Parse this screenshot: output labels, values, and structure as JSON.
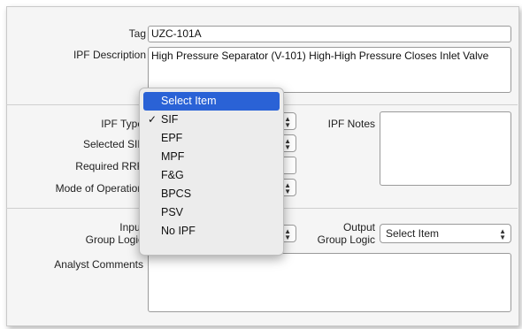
{
  "form": {
    "tag_label": "Tag",
    "tag_value": "UZC-101A",
    "ipf_description_label": "IPF Description",
    "ipf_description_value": "High Pressure Separator (V-101) High-High Pressure Closes Inlet Valve",
    "ipf_type_label": "IPF Type",
    "selected_sil_label": "Selected SIL",
    "required_rrf_label": "Required RRF",
    "mode_of_operation_label": "Mode of Operation",
    "ipf_notes_label": "IPF Notes",
    "input_group_logic_label_line1": "Input",
    "input_group_logic_label_line2": "Group Logic",
    "output_group_logic_label_line1": "Output",
    "output_group_logic_label_line2": "Group Logic",
    "output_group_logic_value": "Select Item",
    "analyst_comments_label": "Analyst Comments"
  },
  "dropdown": {
    "items": [
      {
        "label": "Select Item",
        "highlighted": true,
        "checked": false
      },
      {
        "label": "SIF",
        "highlighted": false,
        "checked": true
      },
      {
        "label": "EPF",
        "highlighted": false,
        "checked": false
      },
      {
        "label": "MPF",
        "highlighted": false,
        "checked": false
      },
      {
        "label": "F&G",
        "highlighted": false,
        "checked": false
      },
      {
        "label": "BPCS",
        "highlighted": false,
        "checked": false
      },
      {
        "label": "PSV",
        "highlighted": false,
        "checked": false
      },
      {
        "label": "No IPF",
        "highlighted": false,
        "checked": false
      }
    ],
    "check_glyph": "✓",
    "highlight_color": "#2a62d6"
  }
}
